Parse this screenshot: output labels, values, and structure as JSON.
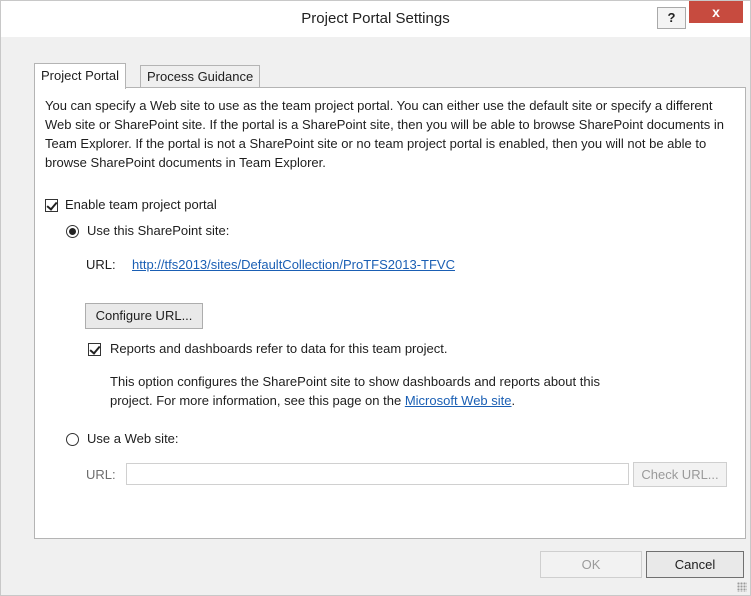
{
  "window": {
    "title": "Project Portal Settings",
    "help_label": "?",
    "close_label": "x"
  },
  "tabs": [
    {
      "label": "Project Portal",
      "active": true
    },
    {
      "label": "Process Guidance",
      "active": false
    }
  ],
  "portal": {
    "description": "You can specify a Web site to use as the team project portal. You can either use the default site or specify a different Web site or SharePoint site. If the portal is a SharePoint site, then you will be able to browse SharePoint documents in Team Explorer. If the portal is not a SharePoint site or no team project portal is enabled, then you will not be able to browse SharePoint documents in Team Explorer.",
    "enable_label": "Enable team project portal",
    "enable_checked": true,
    "sharepoint_radio_label": "Use this SharePoint site:",
    "sharepoint_selected": true,
    "url_label": "URL:",
    "url_value": "http://tfs2013/sites/DefaultCollection/ProTFS2013-TFVC",
    "configure_button": "Configure URL...",
    "reports_label": "Reports and dashboards refer to data for this team project.",
    "reports_checked": true,
    "reports_info_1": "This option configures the SharePoint site to show dashboards and reports about this",
    "reports_info_2": "project. For more information, see this page on the ",
    "reports_link": "Microsoft Web site",
    "reports_info_end": ".",
    "website_radio_label": "Use a Web site:",
    "website_url_label": "URL:",
    "website_url_value": "",
    "check_url_button": "Check URL..."
  },
  "footer": {
    "ok_label": "OK",
    "cancel_label": "Cancel"
  }
}
